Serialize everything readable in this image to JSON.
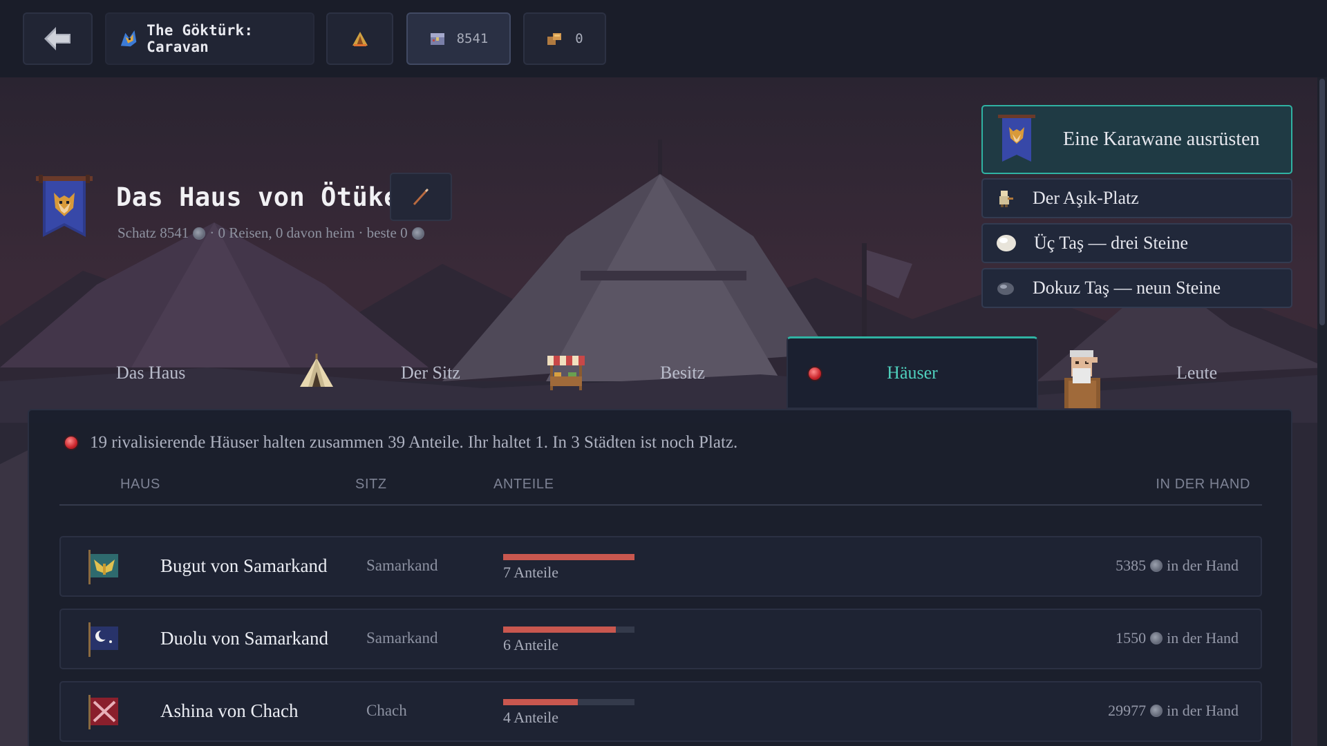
{
  "topbar": {
    "back_icon": "arrow-left-icon",
    "title": "The Göktürk: Caravan",
    "title_icon": "wolf-head-icon",
    "camp_icon": "campfire-tent-icon",
    "treasure_icon": "treasure-chest-icon",
    "treasure_value": "8541",
    "goods_icon": "goods-crate-icon",
    "goods_value": "0"
  },
  "house": {
    "title": "Das Haus von Ötüken",
    "edit_icon": "pen-icon",
    "banner_icon": "wolf-banner-icon",
    "sub_treasure": "Schatz 8541",
    "sub_stats": "· 0 Reisen, 0 davon heim · beste 0"
  },
  "menu": {
    "primary": "Eine Karawane ausrüsten",
    "asik": "Der Aşık-Platz",
    "uc": "Üç Taş — drei Steine",
    "dokuz": "Dokuz Taş — neun Steine"
  },
  "tabs": {
    "haus": "Das Haus",
    "sitz": "Der Sitz",
    "besitz": "Besitz",
    "haeuser": "Häuser",
    "leute": "Leute",
    "active": "Häuser"
  },
  "panel": {
    "summary": "19 rivalisierende Häuser halten zusammen 39 Anteile. Ihr haltet 1. In 3 Städten ist noch Platz.",
    "columns": {
      "haus": "HAUS",
      "sitz": "SITZ",
      "anteile": "ANTEILE",
      "hand": "IN DER HAND"
    },
    "rows": [
      {
        "name": "Bugut von Samarkand",
        "seat": "Samarkand",
        "shares": "7 Anteile",
        "share_fill": 1.0,
        "hand_amount": "5385",
        "hand_label": "in der Hand",
        "flag_color": "#2e6a6e",
        "flag_icon": "eagle-flag-icon"
      },
      {
        "name": "Duolu von Samarkand",
        "seat": "Samarkand",
        "shares": "6 Anteile",
        "share_fill": 0.857,
        "hand_amount": "1550",
        "hand_label": "in der Hand",
        "flag_color": "#28336a",
        "flag_icon": "crescent-flag-icon"
      },
      {
        "name": "Ashina von Chach",
        "seat": "Chach",
        "shares": "4 Anteile",
        "share_fill": 0.571,
        "hand_amount": "29977",
        "hand_label": "in der Hand",
        "flag_color": "#8a1f2c",
        "flag_icon": "crossed-swords-flag-icon"
      }
    ]
  },
  "colors": {
    "accent": "#2fb3a3",
    "bar_fill": "#c9574f",
    "alert_red": "#c9242b"
  }
}
